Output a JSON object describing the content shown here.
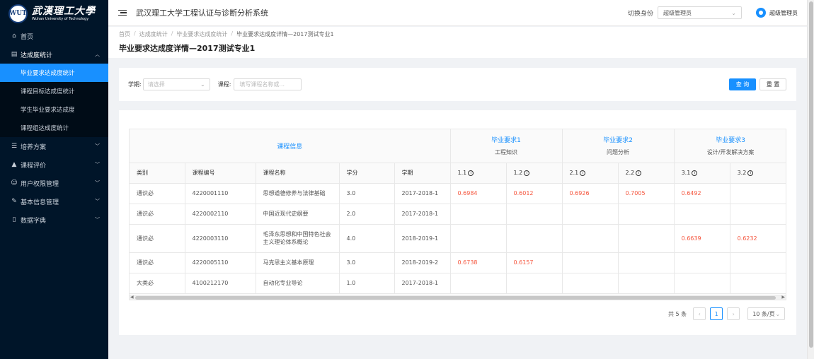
{
  "brand": {
    "emblem_text": "WUT",
    "name_cn": "武漢理工大學",
    "name_en": "Wuhan University of Technology"
  },
  "sidebar": {
    "items": [
      {
        "label": "首页",
        "icon": "home-icon"
      },
      {
        "label": "达成度统计",
        "icon": "document-icon",
        "open": true,
        "children": [
          {
            "label": "毕业要求达成度统计",
            "active": true
          },
          {
            "label": "课程目标达成度统计"
          },
          {
            "label": "学生毕业要求达成度"
          },
          {
            "label": "课程组达成度统计"
          }
        ]
      },
      {
        "label": "培养方案",
        "icon": "list-icon"
      },
      {
        "label": "课程评价",
        "icon": "cap-icon"
      },
      {
        "label": "用户权限管理",
        "icon": "users-icon"
      },
      {
        "label": "基本信息管理",
        "icon": "edit-icon"
      },
      {
        "label": "数据字典",
        "icon": "book-icon"
      }
    ]
  },
  "header": {
    "title": "武汉理工大学工程认证与诊断分析系统",
    "switch_label": "切换身份",
    "role_value": "超级管理员",
    "user_name": "超级管理员"
  },
  "breadcrumb": [
    "首页",
    "达成度统计",
    "毕业要求达成度统计",
    "毕业要求达成度详情—2017测试专业1"
  ],
  "page_title": "毕业要求达成度详情—2017测试专业1",
  "filter": {
    "term_label": "学期:",
    "term_placeholder": "请选择",
    "course_label": "课程:",
    "course_placeholder": "填写课程名称或...",
    "query_button": "查 询",
    "reset_button": "重 置"
  },
  "table": {
    "group_headers": [
      {
        "title": "课程信息",
        "sub": ""
      },
      {
        "title": "毕业要求1",
        "sub": "工程知识"
      },
      {
        "title": "毕业要求2",
        "sub": "问题分析"
      },
      {
        "title": "毕业要求3",
        "sub": "设计/开发解决方案"
      }
    ],
    "columns": [
      "类别",
      "课程编号",
      "课程名称",
      "学分",
      "学期",
      "1.1",
      "1.2",
      "2.1",
      "2.2",
      "3.1",
      "3.2"
    ],
    "rows": [
      [
        "通识必",
        "4220001110",
        "思想道德修养与法律基础",
        "3.0",
        "2017-2018-1",
        "0.6984",
        "0.6012",
        "0.6926",
        "0.7005",
        "0.6492",
        ""
      ],
      [
        "通识必",
        "4220002110",
        "中国近现代史纲要",
        "2.0",
        "2017-2018-1",
        "",
        "",
        "",
        "",
        "",
        ""
      ],
      [
        "通识必",
        "4220003110",
        "毛泽东思想和中国特色社会主义理论体系概论",
        "4.0",
        "2018-2019-1",
        "",
        "",
        "",
        "",
        "0.6639",
        "0.6232"
      ],
      [
        "通识必",
        "4220005110",
        "马克思主义基本原理",
        "3.0",
        "2018-2019-2",
        "0.6738",
        "0.6157",
        "",
        "",
        "",
        ""
      ],
      [
        "大类必",
        "4100212170",
        "自动化专业导论",
        "1.0",
        "2017-2018-1",
        "",
        "",
        "",
        "",
        "",
        ""
      ]
    ]
  },
  "pagination": {
    "total": "共 5 条",
    "current_page": "1",
    "page_size": "10 条/页"
  },
  "colors": {
    "accent": "#1890ff",
    "sidebar_bg": "#001529",
    "value_red": "#f5553d"
  }
}
